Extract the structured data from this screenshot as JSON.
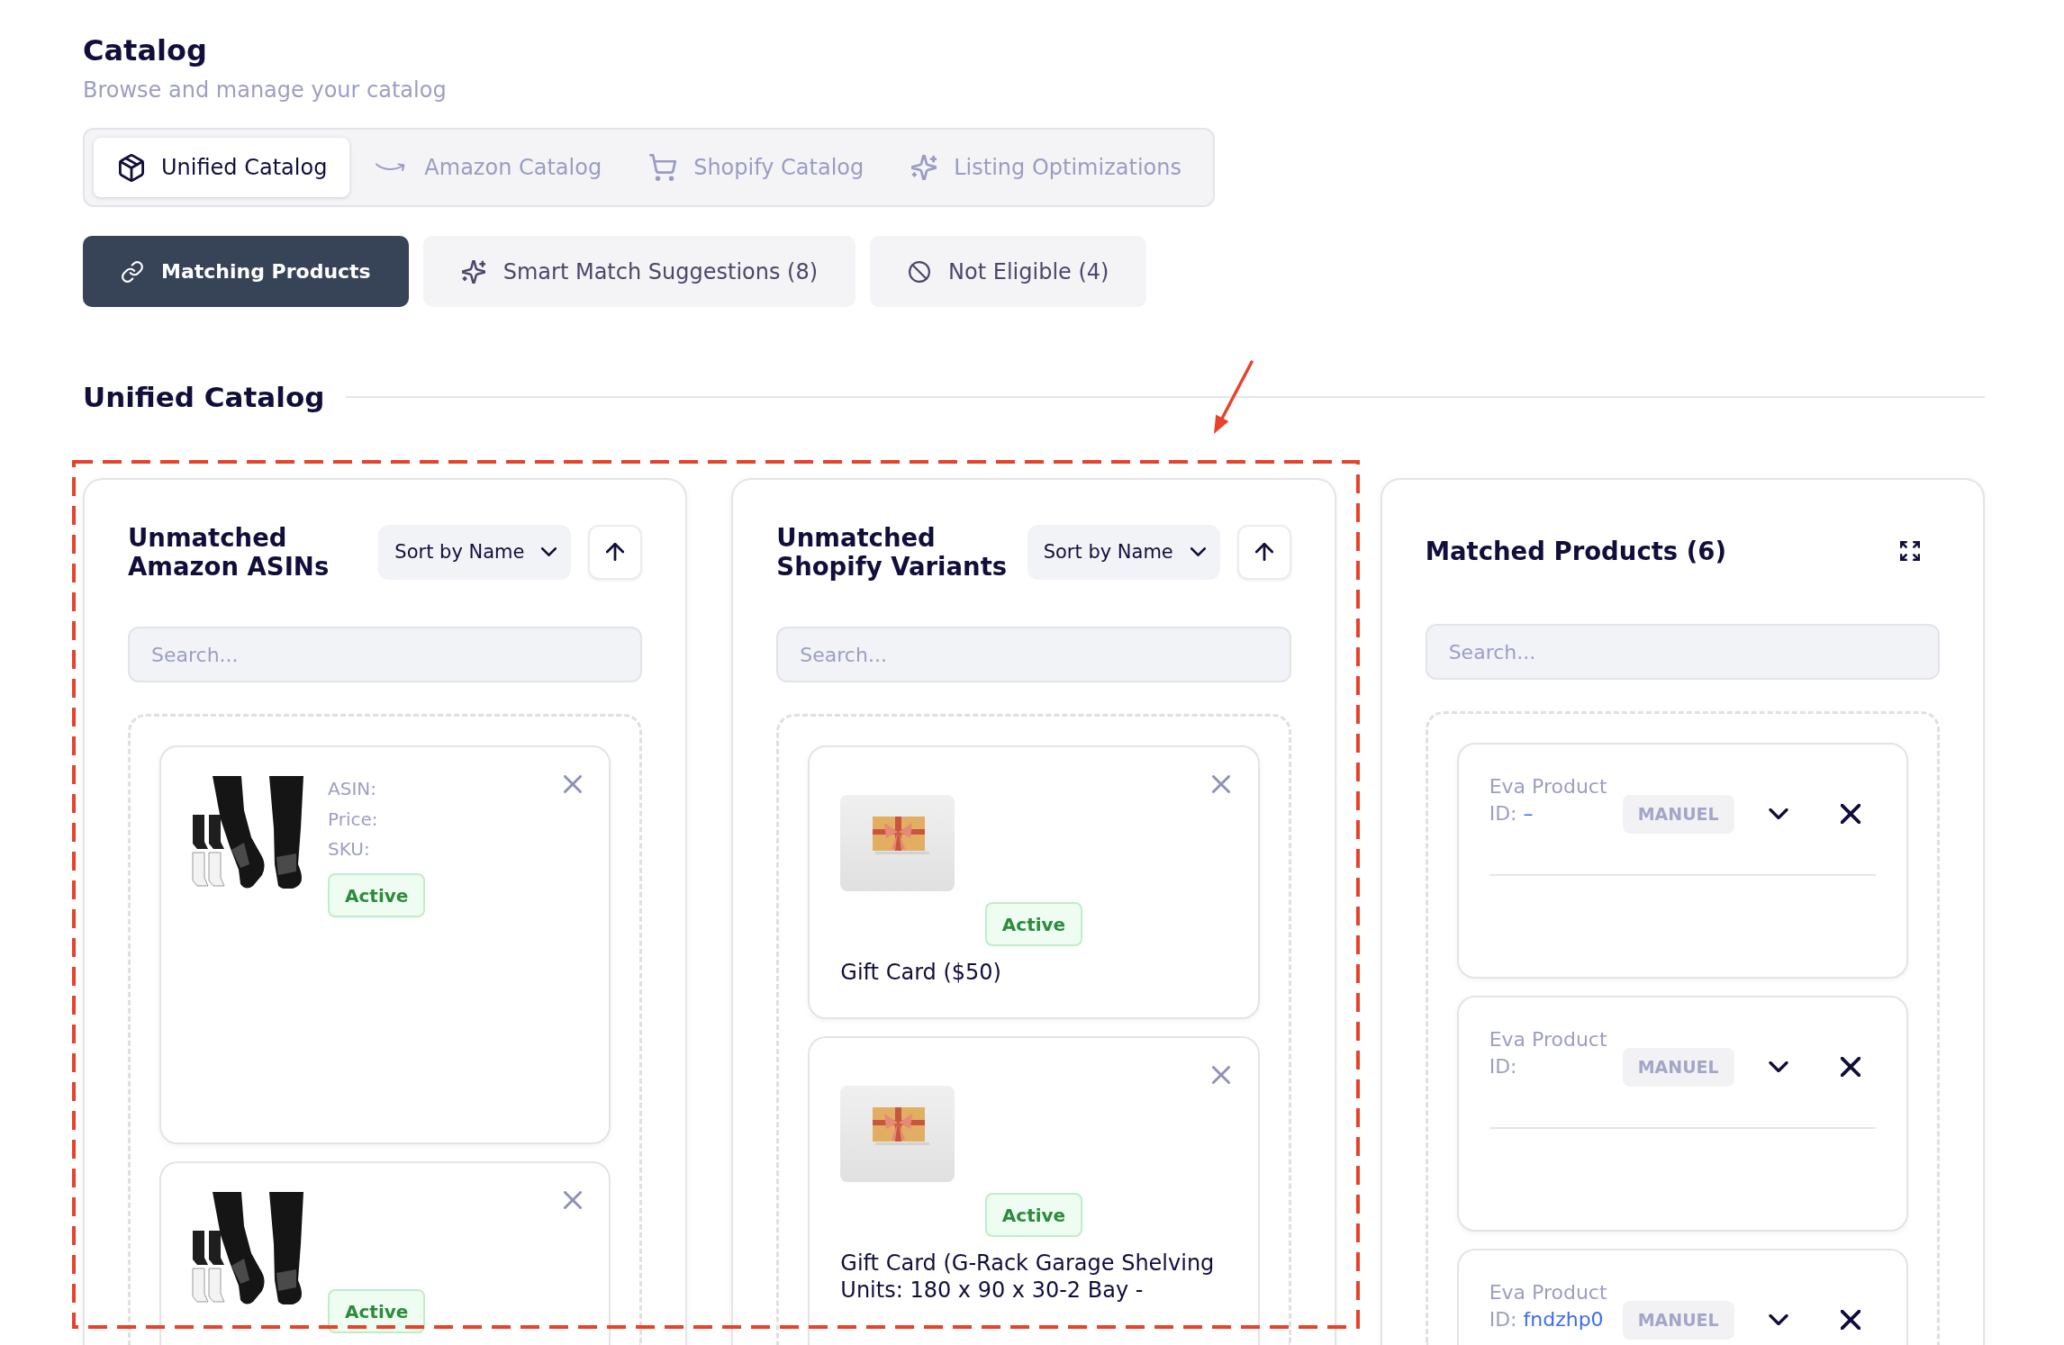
{
  "page": {
    "title": "Catalog",
    "subtitle": "Browse and manage your catalog"
  },
  "tabs": [
    {
      "label": "Unified Catalog",
      "selected": true
    },
    {
      "label": "Amazon Catalog",
      "selected": false
    },
    {
      "label": "Shopify Catalog",
      "selected": false
    },
    {
      "label": "Listing Optimizations",
      "selected": false
    }
  ],
  "views": [
    {
      "label": "Matching Products",
      "selected": true
    },
    {
      "label": "Smart Match Suggestions (8)",
      "selected": false
    },
    {
      "label": "Not Eligible (4)",
      "selected": false
    }
  ],
  "section": {
    "title": "Unified Catalog"
  },
  "markup": {
    "highlight_frame": true,
    "pointer_arrow": true
  },
  "columns": [
    {
      "kind": "amazon",
      "title": "Unmatched Amazon ASINs",
      "sort": {
        "label": "Sort by Name",
        "ascending": true
      },
      "search": {
        "placeholder": "Search..."
      },
      "items": [
        {
          "fields": [
            "ASIN:",
            "Price:",
            "SKU:"
          ],
          "status": "Active"
        },
        {
          "status": "Active"
        }
      ]
    },
    {
      "kind": "shopify",
      "title": "Unmatched Shopify Variants",
      "sort": {
        "label": "Sort by Name",
        "ascending": true
      },
      "search": {
        "placeholder": "Search..."
      },
      "items": [
        {
          "status": "Active",
          "name": "Gift Card ($50)"
        },
        {
          "status": "Active",
          "name": "Gift Card (G-Rack Garage Shelving Units: 180 x 90 x 30-2 Bay -"
        }
      ]
    },
    {
      "kind": "matched",
      "title": "Matched Products (6)",
      "search": {
        "placeholder": "Search..."
      },
      "items": [
        {
          "label": "Eva Product",
          "id_label": "ID:",
          "id_value": "–",
          "source": "MANUEL",
          "expanded": false
        },
        {
          "label": "Eva Product",
          "id_label": "ID:",
          "source": "MANUEL",
          "expanded": false
        },
        {
          "label": "Eva Product",
          "id_label": "ID:",
          "id_value": "fndzhp0",
          "source": "MANUEL",
          "expanded": false
        }
      ]
    }
  ]
}
